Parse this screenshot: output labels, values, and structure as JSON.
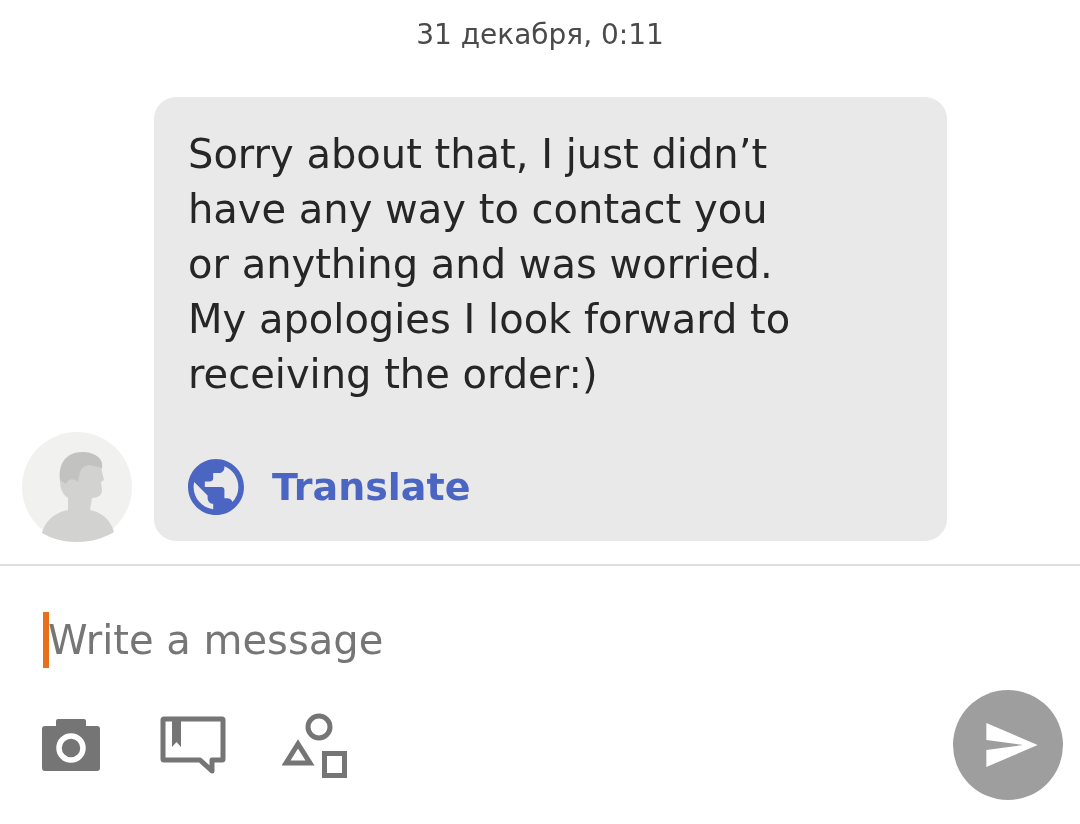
{
  "timestamp": "31 декабря, 0:11",
  "message": {
    "text": "Sorry about that, I just didn’t have any way to contact you or anything and was worried. My apologies I look forward to receiving the order:)",
    "translate_label": "Translate"
  },
  "composer": {
    "placeholder": "Write a message",
    "focused": true
  },
  "send_button": {
    "disabled": true
  }
}
